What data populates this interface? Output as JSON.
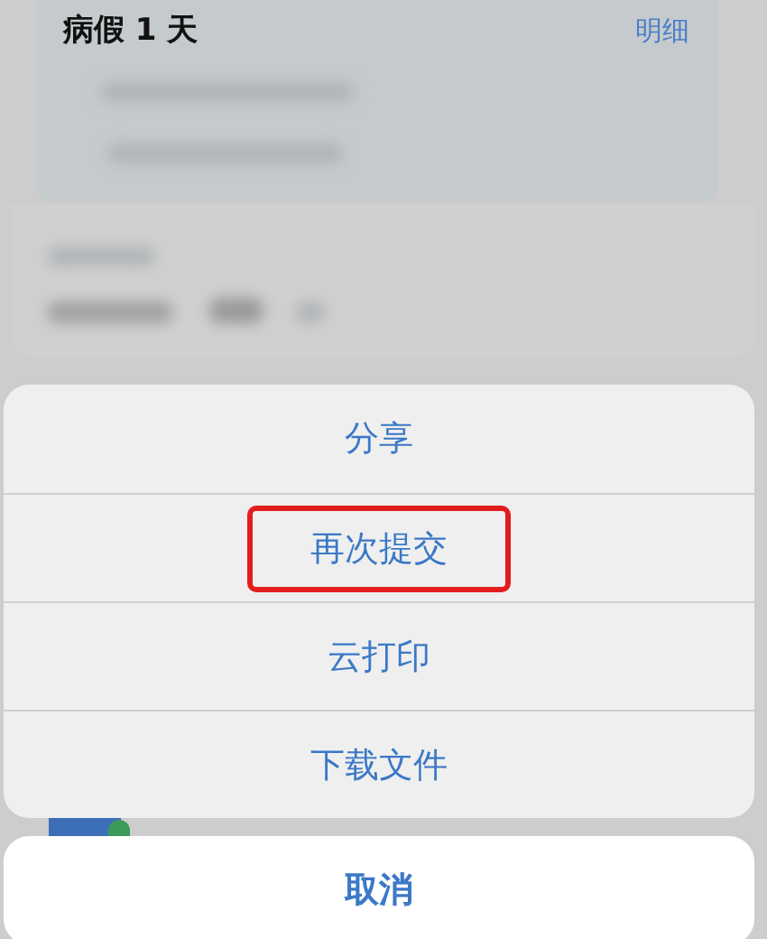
{
  "background": {
    "title": "病假 1 天",
    "detail_link": "明细"
  },
  "action_sheet": {
    "items": [
      {
        "label": "分享",
        "highlighted": false
      },
      {
        "label": "再次提交",
        "highlighted": true
      },
      {
        "label": "云打印",
        "highlighted": false
      },
      {
        "label": "下载文件",
        "highlighted": false
      }
    ],
    "cancel": "取消"
  }
}
